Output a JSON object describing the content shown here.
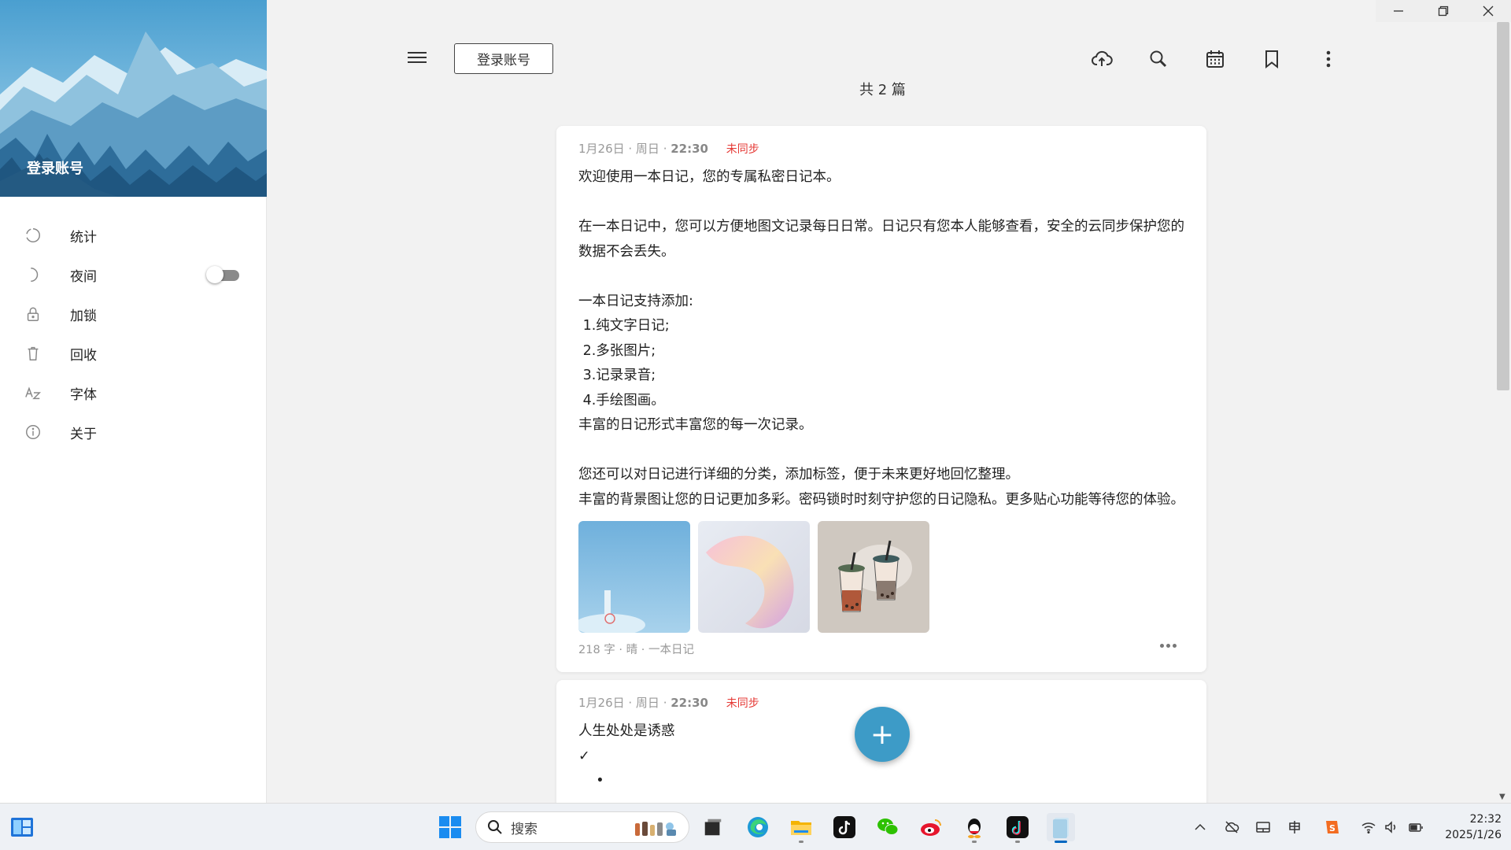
{
  "sidebar": {
    "login_label": "登录账号",
    "items": [
      {
        "label": "统计",
        "icon": "stats-ring-icon"
      },
      {
        "label": "夜间",
        "icon": "moon-icon",
        "toggle": false
      },
      {
        "label": "加锁",
        "icon": "lock-icon"
      },
      {
        "label": "回收",
        "icon": "trash-icon"
      },
      {
        "label": "字体",
        "icon": "font-az-icon"
      },
      {
        "label": "关于",
        "icon": "info-icon"
      }
    ]
  },
  "toolbar": {
    "login_button": "登录账号",
    "count_text": "共 2 篇",
    "icons": [
      "menu-icon",
      "cloud-upload-icon",
      "search-icon",
      "calendar-icon",
      "bookmark-icon",
      "more-vert-icon"
    ]
  },
  "entries": [
    {
      "date": "1月26日 · 周日 · ",
      "time": "22:30",
      "status": "未同步",
      "lines": [
        "欢迎使用一本日记，您的专属私密日记本。",
        "",
        "在一本日记中，您可以方便地图文记录每日日常。日记只有您本人能够查看，安全的云同步保护您的",
        "数据不会丢失。",
        "",
        "一本日记支持添加:",
        " 1.纯文字日记;",
        " 2.多张图片;",
        " 3.记录录音;",
        " 4.手绘图画。",
        "丰富的日记形式丰富您的每一次记录。",
        "",
        "您还可以对日记进行详细的分类，添加标签，便于未来更好地回忆整理。",
        "丰富的背景图让您的日记更加多彩。密码锁时时刻守护您的日记隐私。更多贴心功能等待您的体验。"
      ],
      "images": [
        "sky-photo",
        "pink-abstract-photo",
        "bubble-tea-illustration"
      ],
      "footer": "218 字 · 晴 · 一本日记"
    },
    {
      "date": "1月26日 · 周日 · ",
      "time": "22:30",
      "status": "未同步",
      "lines": [
        "人生处处是诱惑",
        "✓",
        "    •"
      ]
    }
  ],
  "fab_label": "+",
  "taskbar": {
    "search_placeholder": "搜索",
    "clock_time": "22:32",
    "clock_date": "2025/1/26"
  },
  "colors": {
    "accent": "#3d9bc7",
    "unsynced": "#e53935",
    "background": "#f2f2f2"
  }
}
